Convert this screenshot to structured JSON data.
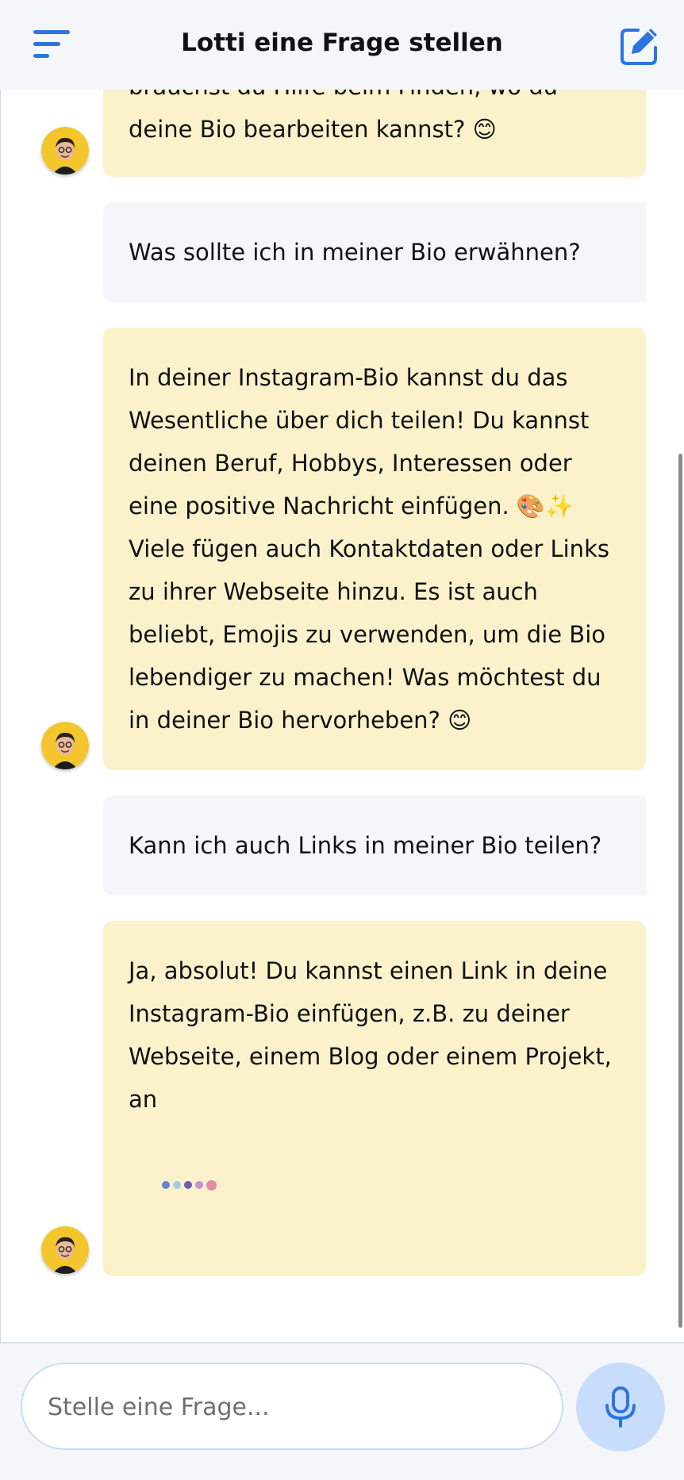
{
  "header": {
    "title": "Lotti eine Frage stellen",
    "menu_icon": "menu-lines-icon",
    "compose_icon": "compose-icon"
  },
  "messages": [
    {
      "role": "assistant",
      "text": "brauchst du Hilfe beim Finden, wo du deine Bio bearbeiten kannst? 😊"
    },
    {
      "role": "user",
      "text": "Was sollte ich in meiner Bio erwähnen?"
    },
    {
      "role": "assistant",
      "text": "In deiner Instagram-Bio kannst du das Wesentliche über dich teilen! Du kannst deinen Beruf, Hobbys, Interessen oder eine positive Nachricht einfügen. 🎨✨ Viele fügen auch Kontaktdaten oder Links zu ihrer Webseite hinzu. Es ist auch beliebt, Emojis zu verwenden, um die Bio lebendiger zu machen! Was möchtest du in deiner Bio hervorheben? 😊"
    },
    {
      "role": "user",
      "text": "Kann ich auch Links in meiner Bio teilen?"
    },
    {
      "role": "assistant",
      "text": "Ja, absolut! Du kannst einen Link in deine Instagram-Bio einfügen, z.B. zu deiner Webseite, einem Blog oder einem Projekt, an"
    }
  ],
  "typing_indicator": {
    "colors": [
      "#6a7fd8",
      "#9fcfe8",
      "#6e58b8",
      "#c98fd6",
      "#e38aa5"
    ]
  },
  "composer": {
    "placeholder": "Stelle eine Frage...",
    "value": "",
    "mic_icon": "microphone-icon"
  },
  "colors": {
    "assistant_bubble": "#fbf2cc",
    "user_bubble": "#f5f6fa",
    "accent": "#2d74e0",
    "avatar_ring": "#f2c62c"
  }
}
